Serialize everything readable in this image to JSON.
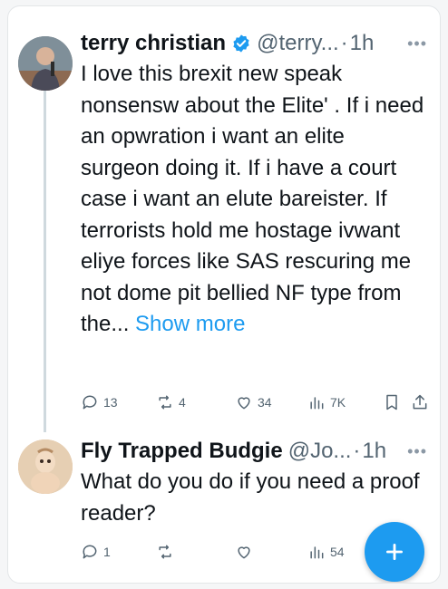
{
  "post1": {
    "name": "terry christian",
    "handle": "@terry...",
    "time": "1h",
    "text": "I love this brexit new speak nonsensw about the Elite' . If i need an opwration i want an elite surgeon doing it. If  i have a court case i want an elute bareister. If terrorists hold me hostage ivwant eliye forces like SAS rescuring me not dome pit bellied NF type from the...",
    "show_more": "Show more",
    "stats": {
      "replies": "13",
      "reposts": "4",
      "likes": "34",
      "views": "7K"
    }
  },
  "post2": {
    "name": "Fly Trapped Budgie",
    "handle": "@Jo...",
    "time": "1h",
    "text": "What do you do if you need a proof reader?",
    "stats": {
      "replies": "1",
      "reposts": "",
      "likes": "",
      "views": "54"
    }
  },
  "fab": {
    "label": "+"
  },
  "colors": {
    "accent": "#1d9bf0",
    "text": "#0f1419",
    "muted": "#536471"
  },
  "icons": [
    "verified-badge-icon",
    "more-icon",
    "reply-icon",
    "repost-icon",
    "like-icon",
    "views-icon",
    "bookmark-icon",
    "share-icon",
    "compose-icon"
  ]
}
